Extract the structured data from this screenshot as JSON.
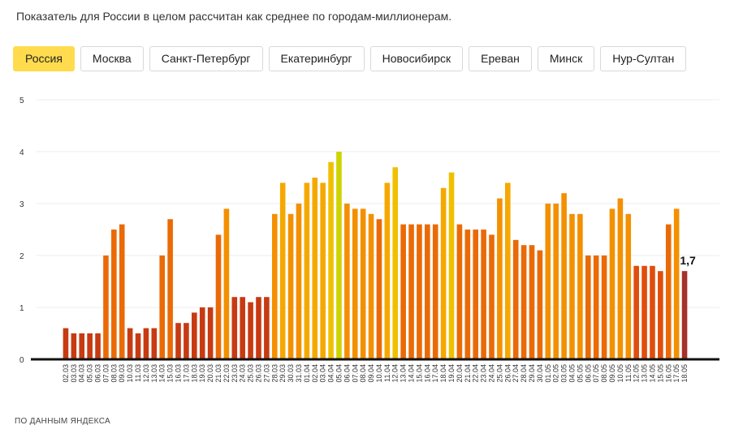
{
  "subtitle": "Показатель для России в целом рассчитан как среднее по городам-миллионерам.",
  "tabs": [
    {
      "label": "Россия",
      "active": true
    },
    {
      "label": "Москва",
      "active": false
    },
    {
      "label": "Санкт-Петербург",
      "active": false
    },
    {
      "label": "Екатеринбург",
      "active": false
    },
    {
      "label": "Новосибирск",
      "active": false
    },
    {
      "label": "Ереван",
      "active": false
    },
    {
      "label": "Минск",
      "active": false
    },
    {
      "label": "Нур-Султан",
      "active": false
    }
  ],
  "footnote": "ПО ДАННЫМ ЯНДЕКСА",
  "colors": {
    "accent": "#ffdb4d"
  },
  "chart_data": {
    "type": "bar",
    "ylim": [
      0,
      5
    ],
    "yticks": [
      "0",
      "1",
      "2",
      "3",
      "4",
      "5"
    ],
    "grid": true,
    "last_value_label": "1,7",
    "categories": [
      "02.03",
      "03.03",
      "04.03",
      "05.03",
      "06.03",
      "07.03",
      "08.03",
      "09.03",
      "10.03",
      "11.03",
      "12.03",
      "13.03",
      "14.03",
      "15.03",
      "16.03",
      "17.03",
      "18.03",
      "19.03",
      "20.03",
      "21.03",
      "22.03",
      "23.03",
      "24.03",
      "25.03",
      "26.03",
      "27.03",
      "28.03",
      "29.03",
      "30.03",
      "31.03",
      "01.04",
      "02.04",
      "03.04",
      "04.04",
      "05.04",
      "06.04",
      "07.04",
      "08.04",
      "09.04",
      "10.04",
      "11.04",
      "12.04",
      "13.04",
      "14.04",
      "15.04",
      "16.04",
      "17.04",
      "18.04",
      "19.04",
      "20.04",
      "21.04",
      "22.04",
      "23.04",
      "24.04",
      "25.04",
      "26.04",
      "27.04",
      "28.04",
      "29.04",
      "30.04",
      "01.05",
      "02.05",
      "03.05",
      "04.05",
      "05.05",
      "06.05",
      "07.05",
      "08.05",
      "09.05",
      "10.05",
      "11.05",
      "12.05",
      "13.05",
      "14.05",
      "15.05",
      "16.05",
      "17.05",
      "18.05"
    ],
    "values": [
      0.6,
      0.5,
      0.5,
      0.5,
      0.5,
      2.0,
      2.5,
      2.6,
      0.6,
      0.5,
      0.6,
      0.6,
      2.0,
      2.7,
      0.7,
      0.7,
      0.9,
      1.0,
      1.0,
      2.4,
      2.9,
      1.2,
      1.2,
      1.1,
      1.2,
      1.2,
      2.8,
      3.4,
      2.8,
      3.0,
      3.4,
      3.5,
      3.4,
      3.8,
      4.0,
      3.0,
      2.9,
      2.9,
      2.8,
      2.7,
      3.4,
      3.7,
      2.6,
      2.6,
      2.6,
      2.6,
      2.6,
      3.3,
      3.6,
      2.6,
      2.5,
      2.5,
      2.5,
      2.4,
      3.1,
      3.4,
      2.3,
      2.2,
      2.2,
      2.1,
      3.0,
      3.0,
      3.2,
      2.8,
      2.8,
      2.0,
      2.0,
      2.0,
      2.9,
      3.1,
      2.8,
      1.8,
      1.8,
      1.8,
      1.7,
      2.6,
      2.9,
      1.7
    ],
    "highlight": {
      "index": 77,
      "color": "#a5322b"
    }
  }
}
